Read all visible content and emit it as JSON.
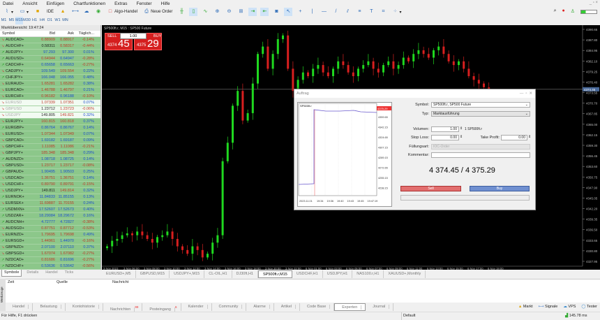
{
  "menu": [
    "Datei",
    "Ansicht",
    "Einfügen",
    "Chartfunktionen",
    "Extras",
    "Fenster",
    "Hilfe"
  ],
  "toolbar": {
    "ide": "IDE",
    "algo": "Algo-Handel",
    "new_order": "Neue Order"
  },
  "timeframes": [
    "M1",
    "M5",
    "M15",
    "M30",
    "H1",
    "H4",
    "D1",
    "W1",
    "MN"
  ],
  "timeframe_active": "M15",
  "market_watch": {
    "title": "Marktübersicht: 19:47:24",
    "headers": [
      "Symbol",
      "Bid",
      "Ask",
      "Täglich..."
    ],
    "rows": [
      [
        "AUDCAD+",
        "0.88909",
        "0.88917",
        "-0.14%",
        "rrr",
        "d"
      ],
      [
        "AUDCHF+",
        "0.58311",
        "0.58317",
        "-0.44%",
        "krr",
        "d"
      ],
      [
        "AUDJPY+",
        "97.293",
        "97.300",
        "0.01%",
        "bbb",
        "u"
      ],
      [
        "AUDUSD+",
        "0.64944",
        "0.64947",
        "-0.28%",
        "rbr",
        "u"
      ],
      [
        "CADCHF+",
        "0.65658",
        "0.65663",
        "-0.27%",
        "bbr",
        "u"
      ],
      [
        "CADJPY+",
        "109.549",
        "109.554",
        "0.22%",
        "brb",
        "d"
      ],
      [
        "CHFJPY+",
        "166.048",
        "166.055",
        "0.48%",
        "bbb",
        "u"
      ],
      [
        "EURAUD+",
        "1.65281",
        "1.65282",
        "0.38%",
        "rrb",
        "d"
      ],
      [
        "EURCAD+",
        "1.46788",
        "1.46797",
        "0.21%",
        "rrb",
        "d"
      ],
      [
        "EURCHF+",
        "0.96182",
        "0.96188",
        "-0.10%",
        "rbr",
        "d"
      ],
      [
        "EURUSD",
        "1.07339",
        "1.07351",
        "0.07%",
        "rrb",
        "d"
      ],
      [
        "GBPUSD",
        "1.23712",
        "1.23723",
        "-0.06%",
        "krr",
        "d"
      ],
      [
        "USDJPY",
        "149.805",
        "149.821",
        "0.32%",
        "krb",
        "d"
      ],
      [
        "EURJPY+",
        "160.815",
        "160.818",
        "0.37%",
        "rrb",
        "d"
      ],
      [
        "EURGBP+",
        "0.86764",
        "0.86767",
        "0.14%",
        "bbb",
        "u"
      ],
      [
        "EURUSD+",
        "1.07344",
        "1.07349",
        "0.07%",
        "rrb",
        "d"
      ],
      [
        "GBPCAD+",
        "1.69182",
        "1.69187",
        "0.09%",
        "bbb",
        "d"
      ],
      [
        "GBPCHF+",
        "1.11085",
        "1.11086",
        "-0.21%",
        "rrr",
        "d"
      ],
      [
        "GBPJPY+",
        "185.348",
        "185.348",
        "0.29%",
        "rrb",
        "d"
      ],
      [
        "AUDNZD+",
        "1.08718",
        "1.08725",
        "0.14%",
        "bbb",
        "u"
      ],
      [
        "GBPUSD+",
        "1.23717",
        "1.23717",
        "-0.08%",
        "rrr",
        "d"
      ],
      [
        "GBPAUD+",
        "1.90495",
        "1.90503",
        "0.25%",
        "bbb",
        "u"
      ],
      [
        "USDCAD+",
        "1.36751",
        "1.36751",
        "0.14%",
        "rrb",
        "d"
      ],
      [
        "USDCHF+",
        "0.89790",
        "0.89791",
        "-0.15%",
        "rrr",
        "d"
      ],
      [
        "USDJPY+",
        "149.811",
        "149.814",
        "0.32%",
        "krb",
        "d"
      ],
      [
        "EURNOK+",
        "11.84833",
        "11.85155",
        "0.13%",
        "bbb",
        "u"
      ],
      [
        "EURSEK+",
        "11.69887",
        "11.70155",
        "0.24%",
        "rrb",
        "d"
      ],
      [
        "USDMXN+",
        "17.52607",
        "17.52673",
        "0.40%",
        "bbb",
        "u"
      ],
      [
        "USDZAR+",
        "18.29084",
        "18.29672",
        "0.16%",
        "bbb",
        "u"
      ],
      [
        "AUDCNH+",
        "4.72777",
        "4.72827",
        "-0.38%",
        "bbr",
        "u"
      ],
      [
        "AUDSGD+",
        "0.87751",
        "0.87712",
        "-0.53%",
        "rrr",
        "d"
      ],
      [
        "EURNZD+",
        "1.79695",
        "1.79698",
        "0.49%",
        "rrb",
        "d"
      ],
      [
        "EURSGD+",
        "1.44961",
        "1.44970",
        "-0.16%",
        "rbr",
        "u"
      ],
      [
        "GBPNZD+",
        "2.07100",
        "2.07110",
        "0.37%",
        "bbb",
        "d"
      ],
      [
        "GBPSGD+",
        "1.67074",
        "1.67082",
        "-0.27%",
        "rrr",
        "d"
      ],
      [
        "NZDCAD+",
        "0.81686",
        "0.81696",
        "-0.27%",
        "rbr",
        "u"
      ],
      [
        "NZDCHF+",
        "0.53636",
        "0.53642",
        "-0.56%",
        "bbr",
        "u"
      ]
    ],
    "tabs": [
      "Symbole",
      "Details",
      "Handel",
      "Ticks"
    ]
  },
  "chart": {
    "title": "SP500ft.r, M15 : SP500 Future",
    "sell_label": "SELL",
    "buy_label": "BUY",
    "lot": "1.00",
    "sell_big": "45",
    "sell_small": "4374",
    "buy_big": "29",
    "buy_small": "4375",
    "current_price": "4374.45",
    "price_ticks": [
      "4390.65",
      "4387.80",
      "4384.95",
      "4382.10",
      "4379.25",
      "4376.40",
      "4373.55",
      "4370.70",
      "4367.85",
      "4365.00",
      "4362.15",
      "4359.30",
      "4356.45",
      "4353.60",
      "4350.75",
      "4347.90",
      "4345.05",
      "4342.20",
      "4339.35",
      "4336.50",
      "4333.65",
      "4330.80",
      "4327.95"
    ],
    "time_ticks": [
      "3 Nov 2023",
      "3 Nov 06:00",
      "3 Nov 08:00",
      "3 Nov 10:00",
      "3 Nov 12:00",
      "3 Nov 14:00",
      "3 Nov 16:00",
      "3 Nov 18:00",
      "3 Nov 20:00",
      "3 Nov 22:00",
      "6 Nov 01:00",
      "6 Nov 03:00",
      "6 Nov 05:00",
      "6 Nov 07:00",
      "6 Nov 09:00",
      "6 Nov 11:00",
      "6 Nov 13:00",
      "6 Nov 15:00",
      "6 Nov 17:00",
      "6 Nov 19:00"
    ],
    "closes": [
      4332,
      4333.5,
      4334,
      4335,
      4335.5,
      4335,
      4336,
      4335,
      4334,
      4333,
      4334.5,
      4335,
      4336,
      4334,
      4332,
      4331,
      4330,
      4332,
      4331,
      4329,
      4330,
      4333,
      4335,
      4355,
      4360,
      4370,
      4374,
      4366,
      4368,
      4376,
      4384,
      4386,
      4380,
      4384,
      4388,
      4389,
      4380,
      4374,
      4377,
      4379,
      4378,
      4380,
      4381,
      4379,
      4378,
      4380,
      4382,
      4381,
      4379,
      4378,
      4380,
      4381,
      4382,
      4380,
      4379,
      4381,
      4382,
      4380,
      4381,
      4383,
      4382,
      4384,
      4385,
      4384,
      4383,
      4385,
      4386,
      4384,
      4382,
      4381,
      4382,
      4380,
      4378,
      4377,
      4376,
      4375,
      4374.5
    ],
    "up_color": "#1fd81f",
    "down_color": "#d81f1f"
  },
  "chart_tabs": [
    "EURUSD+,M5",
    "GBPUSD,M15",
    "USDJPY+,M15",
    "CL-OIL,H1",
    "DJ30ft,H1",
    "SP500ft.r,M15",
    "USDCHF,H1",
    "USDJPY,H1",
    "NAS100.r,H1",
    "XAUUSD+,Monthly"
  ],
  "chart_tab_active": 5,
  "order_dialog": {
    "title": "Auftrag",
    "mini_symbol": "SP500ft.r",
    "mini_price_tag": "4375.29",
    "mini_prices": [
      "4359.65",
      "4342.15",
      "4324.65",
      "4307.15",
      "4289.15",
      "4272.65",
      "4255.15",
      "4238.15"
    ],
    "mini_times": [
      "2023.11.01",
      "19:34",
      "19:36",
      "19:40",
      "19:43",
      "19:45",
      "19:47:19"
    ],
    "symbol_label": "Symbol:",
    "symbol_value": "SP500ft.r, SP500 Future",
    "type_label": "Typ:",
    "type_value": "Marktausführung",
    "volume_label": "Volumen:",
    "volume_value": "1.00",
    "volume_unit": "1 SP500ft.r",
    "sl_label": "Stop Loss:",
    "sl_value": "0.00",
    "tp_label": "Take Profit:",
    "tp_value": "0.00",
    "fill_label": "Füllungsart:",
    "fill_value": "IOC-Order",
    "comment_label": "Kommentar:",
    "comment_value": "",
    "price": "4 374.45 / 4 375.29",
    "sell": "Sell",
    "buy": "Buy"
  },
  "toolbox": {
    "side_label": "Werkzeuge",
    "columns": [
      "Zeit",
      "Quelle",
      "Nachricht"
    ],
    "tabs": [
      "Handel",
      "Belastung",
      "Kontohistorie",
      "Nachrichten",
      "Posteingang",
      "Kalender",
      "Community",
      "Alarme",
      "Artikel",
      "Code Base",
      "Experten",
      "Journal"
    ],
    "badges": {
      "Nachrichten": "99",
      "Posteingang": "6"
    },
    "active": "Experten",
    "right": [
      "Markt",
      "Signale",
      "VPS",
      "Tester"
    ]
  },
  "status": {
    "help": "Für Hilfe, F1 drücken",
    "profile": "Default",
    "ping": "145.78 ms"
  }
}
